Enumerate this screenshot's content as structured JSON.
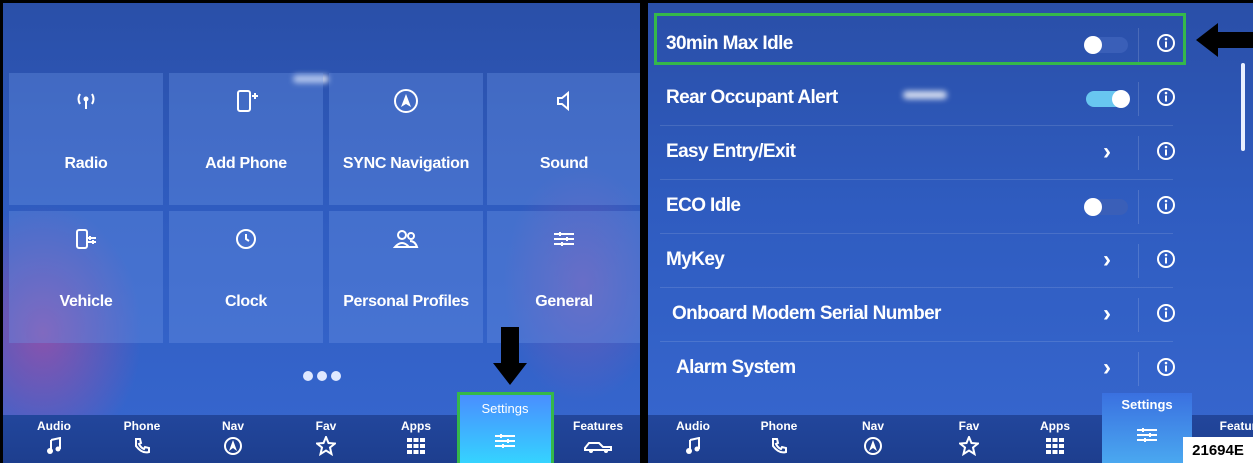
{
  "left_panel": {
    "tiles": [
      {
        "label": "Radio",
        "icon": "radio-icon"
      },
      {
        "label": "Add Phone",
        "icon": "add-phone-icon"
      },
      {
        "label": "SYNC Navigation",
        "icon": "navigation-icon"
      },
      {
        "label": "Sound",
        "icon": "speaker-icon"
      },
      {
        "label": "Vehicle",
        "icon": "vehicle-settings-icon"
      },
      {
        "label": "Clock",
        "icon": "clock-icon"
      },
      {
        "label": "Personal Profiles",
        "icon": "profiles-icon"
      },
      {
        "label": "General",
        "icon": "sliders-icon"
      }
    ],
    "page_dots": 3,
    "nav": [
      {
        "label": "Audio",
        "icon": "music-note-icon"
      },
      {
        "label": "Phone",
        "icon": "phone-icon"
      },
      {
        "label": "Nav",
        "icon": "navigation-icon"
      },
      {
        "label": "Fav",
        "icon": "star-icon"
      },
      {
        "label": "Apps",
        "icon": "grid-icon"
      },
      {
        "label": "Settings",
        "icon": "sliders-icon",
        "selected": true
      },
      {
        "label": "Features",
        "icon": "truck-icon"
      }
    ]
  },
  "right_panel": {
    "rows": [
      {
        "label": "30min Max Idle",
        "control": "toggle",
        "on": false
      },
      {
        "label": "Rear Occupant Alert",
        "control": "toggle",
        "on": true
      },
      {
        "label": "Easy Entry/Exit",
        "control": "chevron"
      },
      {
        "label": "ECO Idle",
        "control": "toggle",
        "on": false
      },
      {
        "label": "MyKey",
        "control": "chevron"
      },
      {
        "label": "Onboard Modem Serial Number",
        "control": "chevron"
      },
      {
        "label": "Alarm System",
        "control": "chevron"
      }
    ],
    "nav": [
      {
        "label": "Audio",
        "icon": "music-note-icon"
      },
      {
        "label": "Phone",
        "icon": "phone-icon"
      },
      {
        "label": "Nav",
        "icon": "navigation-icon"
      },
      {
        "label": "Fav",
        "icon": "star-icon"
      },
      {
        "label": "Apps",
        "icon": "grid-icon"
      },
      {
        "label": "Settings",
        "icon": "sliders-icon",
        "selected": true
      },
      {
        "label": "Featur",
        "icon": "truck-icon"
      }
    ]
  },
  "reference_id": "21694E",
  "colors": {
    "highlight_box": "#35b84a",
    "toggle_on": "#68c6f0"
  }
}
